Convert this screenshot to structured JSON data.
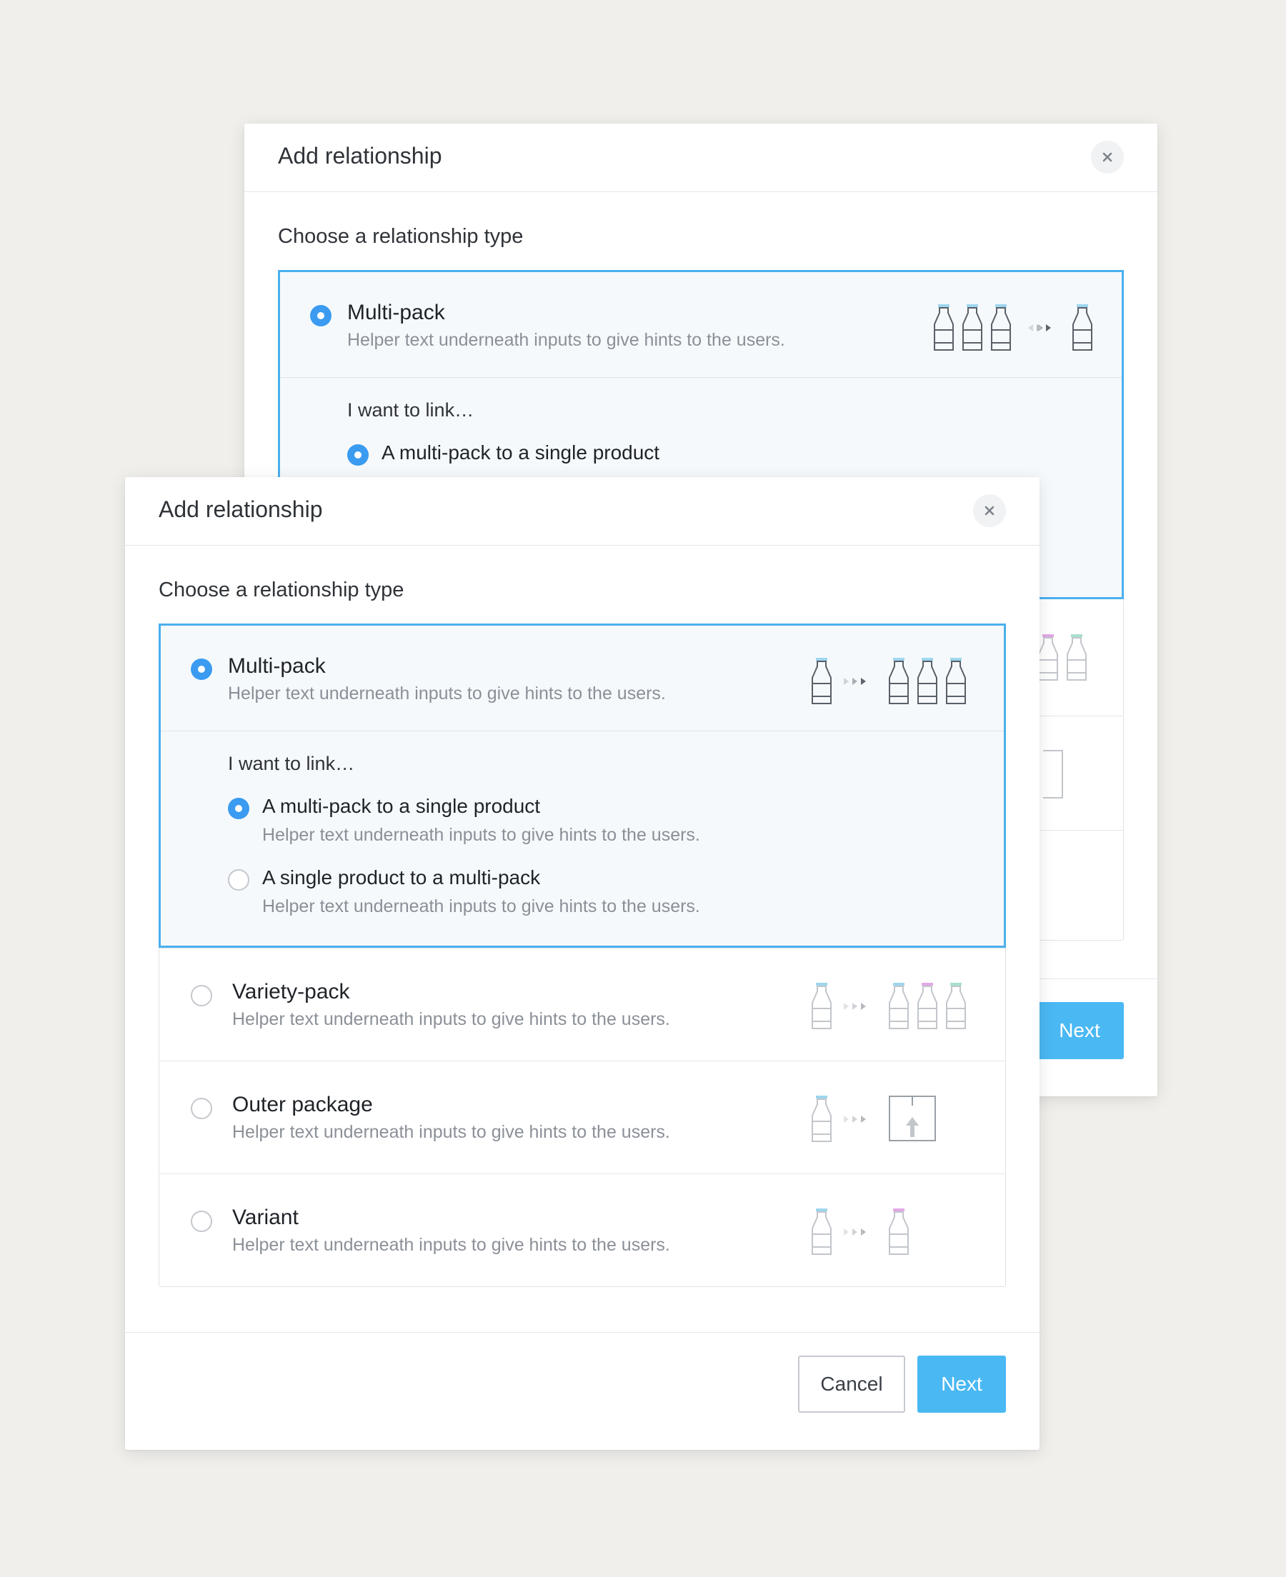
{
  "back_modal": {
    "title": "Add relationship",
    "section_label": "Choose a relationship type",
    "selected_option": {
      "title": "Multi-pack",
      "help": "Helper text underneath inputs to give hints to the users."
    },
    "sub_label": "I want to link…",
    "sub_option": "A multi-pack to a single product",
    "next_label": "Next"
  },
  "front_modal": {
    "title": "Add relationship",
    "section_label": "Choose a relationship type",
    "options": [
      {
        "title": "Multi-pack",
        "help": "Helper text underneath inputs to give hints to the users."
      },
      {
        "title": "Variety-pack",
        "help": "Helper text underneath inputs to give hints to the users."
      },
      {
        "title": "Outer package",
        "help": "Helper text underneath inputs to give hints to the users."
      },
      {
        "title": "Variant",
        "help": "Helper text underneath inputs to give hints to the users."
      }
    ],
    "sub_label": "I want to link…",
    "sub_options": [
      {
        "title": "A multi-pack to a single product",
        "help": "Helper text underneath inputs to give hints to the users."
      },
      {
        "title": "A single product to a multi-pack",
        "help": "Helper text underneath inputs to give hints to the users."
      }
    ],
    "cancel_label": "Cancel",
    "next_label": "Next"
  },
  "icons": {
    "close": "close-icon",
    "bottle": "bottle-icon",
    "arrows": "triple-arrow-icon",
    "box": "outer-box-icon"
  },
  "colors": {
    "accent": "#3a9bf0",
    "selected_border": "#4ab0ee",
    "next_button": "#4ab8f3",
    "bottle_cap_blue": "#9ed6ee",
    "bottle_cap_pink": "#e2a8e6",
    "bottle_cap_green": "#a7e0cc"
  }
}
